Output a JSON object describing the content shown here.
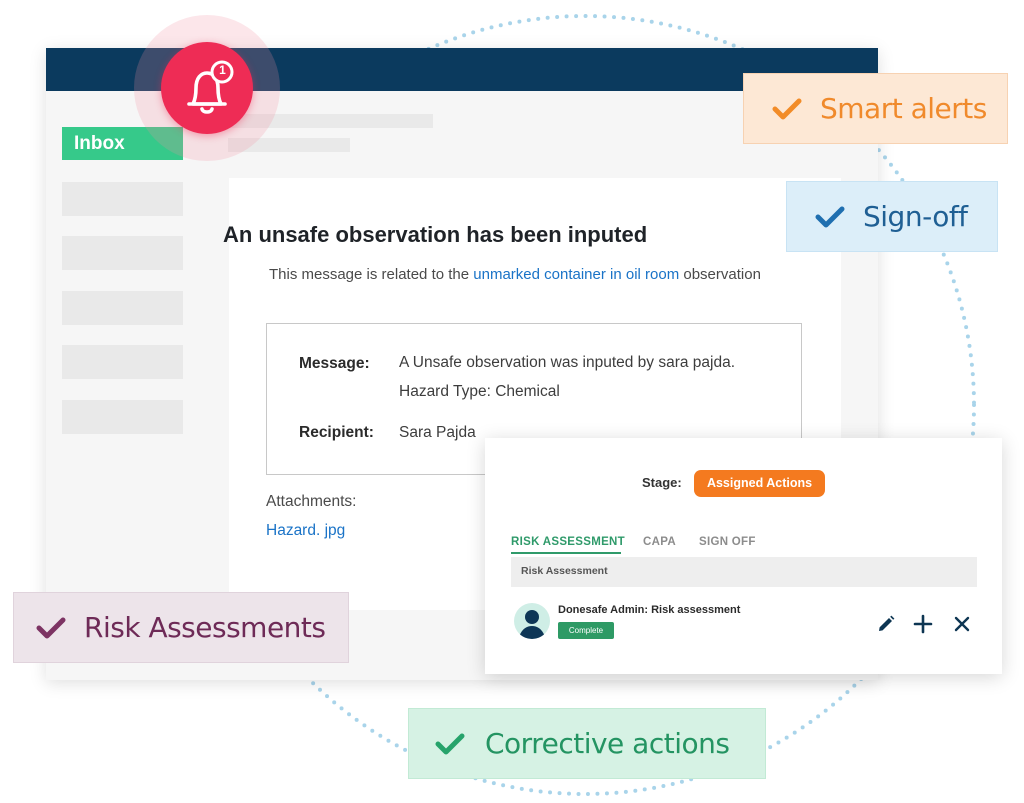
{
  "inbox_label": "Inbox",
  "notification_count": "1",
  "email": {
    "title": "An unsafe observation has been inputed",
    "subtitle_prefix": "This message is related to the ",
    "subtitle_link": "unmarked container in oil room",
    "subtitle_suffix": " observation",
    "message_label": "Message:",
    "message_line1": "A Unsafe observation was inputed by sara pajda.",
    "message_line2": "Hazard Type: Chemical",
    "recipient_label": "Recipient:",
    "recipient_value": "Sara Pajda",
    "attachments_label": "Attachments:",
    "attachment_link": "Hazard. jpg"
  },
  "actions_panel": {
    "stage_label": "Stage:",
    "stage_value": "Assigned Actions",
    "tabs": [
      "RISK ASSESSMENT",
      "CAPA",
      "SIGN OFF"
    ],
    "active_tab": "RISK ASSESSMENT",
    "section_header": "Risk Assessment",
    "assignee": "Donesafe Admin: Risk assessment",
    "status": "Complete",
    "action_icons": [
      "edit-icon",
      "plus-icon",
      "close-icon"
    ]
  },
  "feature_pills": {
    "smart_alerts": "Smart alerts",
    "sign_off": "Sign-off",
    "risk_assessments": "Risk Assessments",
    "corrective_actions": "Corrective actions"
  },
  "colors": {
    "header_navy": "#0b3a5e",
    "inbox_green": "#36c98a",
    "bell_red": "#ee2c55",
    "link_blue": "#1a73c7",
    "stage_orange": "#f47a1f",
    "smart_alerts_check": "#f28c28",
    "sign_off_check": "#1f6fb0",
    "risk_check": "#7d3363",
    "corrective_check": "#27a36b",
    "dotted_circle": "#a9d4ea"
  }
}
